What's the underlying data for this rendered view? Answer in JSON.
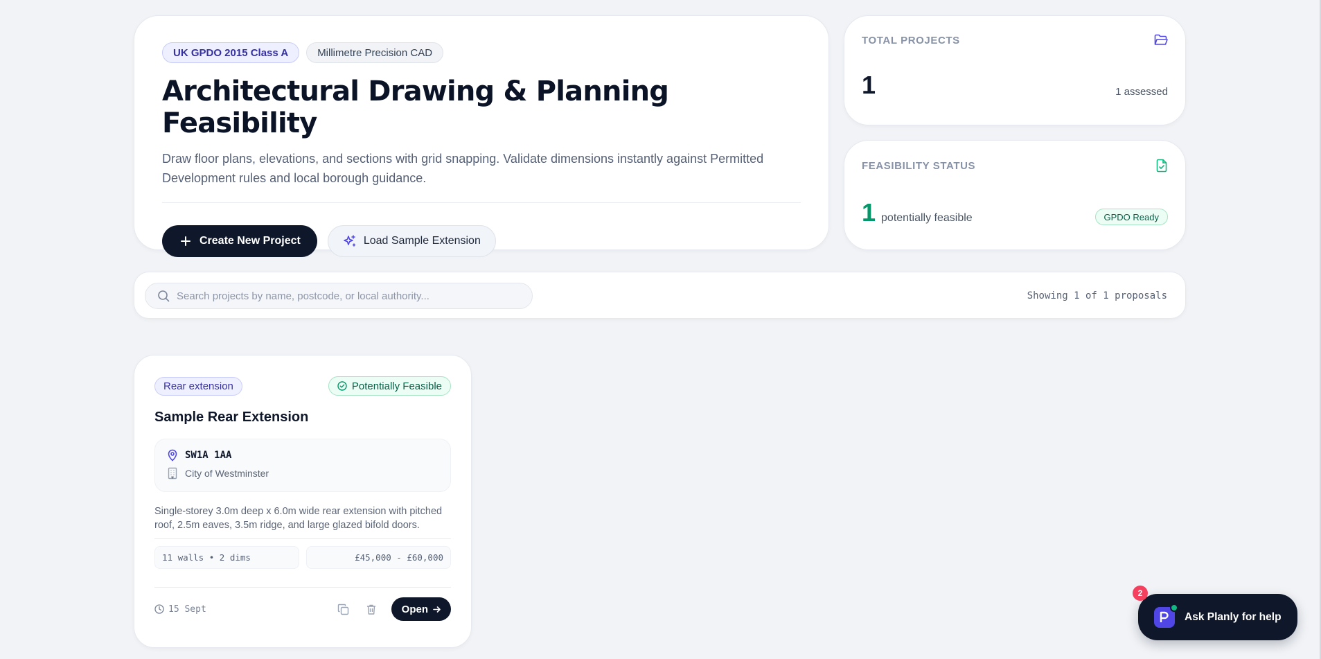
{
  "hero": {
    "pill_primary": "UK GPDO 2015 Class A",
    "pill_secondary": "Millimetre Precision CAD",
    "title": "Architectural Drawing & Planning Feasibility",
    "description": "Draw floor plans, elevations, and sections with grid snapping. Validate dimensions instantly against Permitted Development rules and local borough guidance.",
    "create_label": "Create New Project",
    "sample_label": "Load Sample Extension"
  },
  "stats": {
    "total_label": "TOTAL PROJECTS",
    "total_value": "1",
    "total_sub": "1 assessed",
    "feas_label": "FEASIBILITY STATUS",
    "feas_value": "1",
    "feas_text": "potentially feasible",
    "feas_badge": "GPDO Ready"
  },
  "search": {
    "placeholder": "Search projects by name, postcode, or local authority...",
    "count": "Showing 1 of 1 proposals"
  },
  "project": {
    "tag": "Rear extension",
    "status": "Potentially Feasible",
    "title": "Sample Rear Extension",
    "postcode": "SW1A 1AA",
    "authority": "City of Westminster",
    "description": "Single-storey 3.0m deep x 6.0m wide rear extension with pitched roof, 2.5m eaves, 3.5m ridge, and large glazed bifold doors.",
    "walls_dims": "11 walls • 2 dims",
    "cost": "£45,000 - £60,000",
    "date": "15 Sept",
    "open_label": "Open"
  },
  "help": {
    "label": "Ask Planly for help",
    "badge": "2"
  },
  "colors": {
    "accent": "#4f46e5",
    "success": "#059669",
    "dark": "#0f172a"
  }
}
